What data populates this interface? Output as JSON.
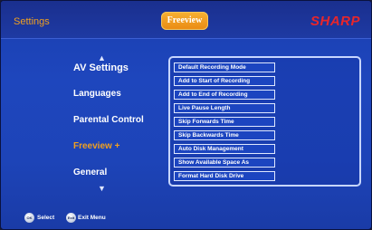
{
  "header": {
    "title": "Settings",
    "channel_logo": "Freeview",
    "brand": "SHARP"
  },
  "menu": {
    "items": [
      {
        "label": "AV Settings",
        "selected": false
      },
      {
        "label": "Languages",
        "selected": false
      },
      {
        "label": "Parental Control",
        "selected": false
      },
      {
        "label": "Freeview +",
        "selected": true
      },
      {
        "label": "General",
        "selected": false
      }
    ]
  },
  "options": [
    "Default Recording Mode",
    "Add to Start of Recording",
    "Add to End of Recording",
    "Live Pause Length",
    "Skip Forwards Time",
    "Skip Backwards Time",
    "Auto Disk Management",
    "Show Available Space As",
    "Format Hard Disk Drive"
  ],
  "footer": {
    "ok_icon": "OK",
    "ok_label": "Select",
    "exit_icon": "Exit",
    "exit_label": "Exit Menu"
  },
  "colors": {
    "accent": "#f0a020",
    "brand": "#e8262b",
    "background": "#1e46bd"
  }
}
